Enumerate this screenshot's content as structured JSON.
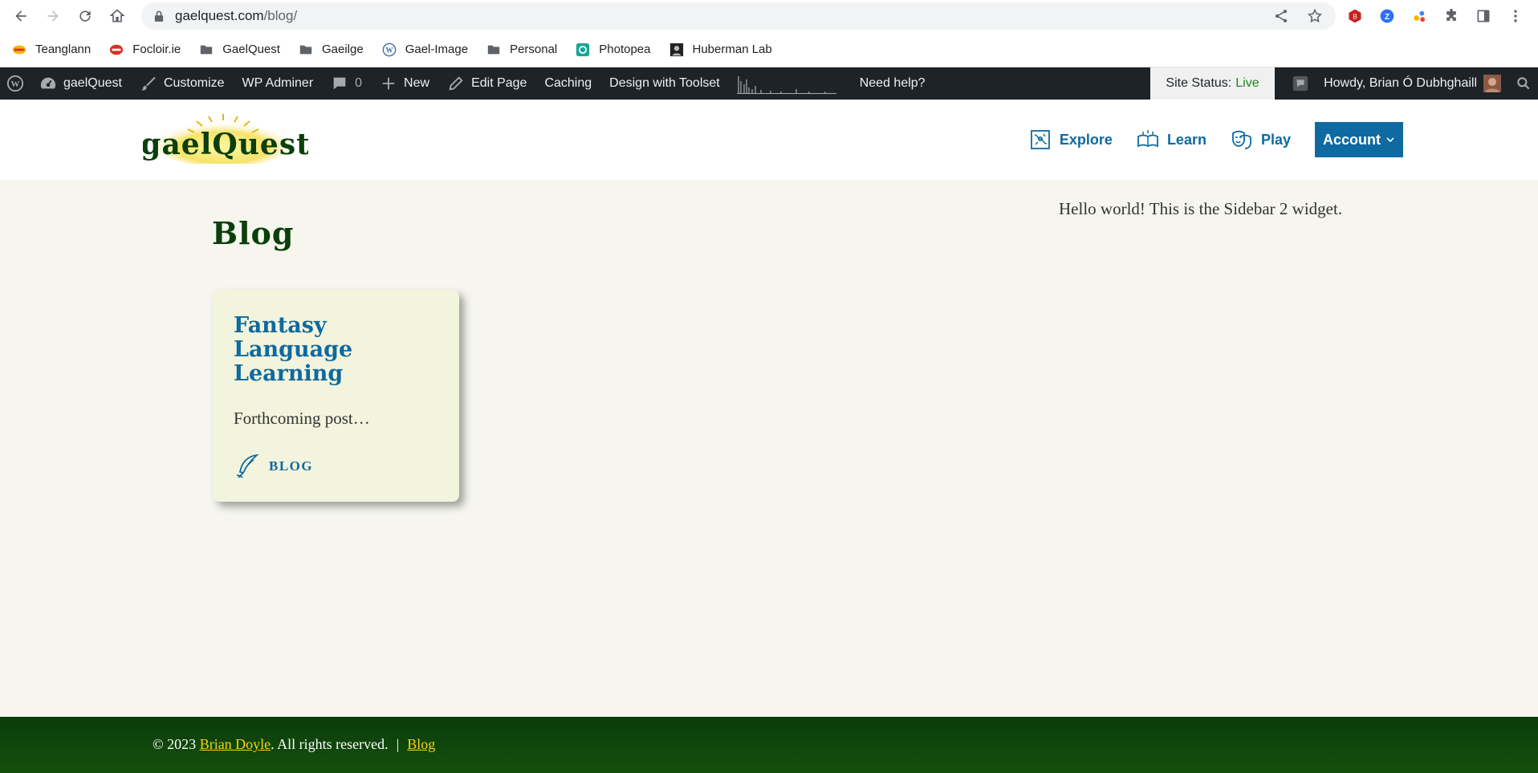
{
  "browser": {
    "url_domain": "gaelquest.com",
    "url_path": "/blog/",
    "bookmarks": [
      {
        "label": "Teanglann",
        "icon": "teanglann-icon"
      },
      {
        "label": "Focloir.ie",
        "icon": "focloir-icon"
      },
      {
        "label": "GaelQuest",
        "icon": "folder-icon"
      },
      {
        "label": "Gaeilge",
        "icon": "folder-icon"
      },
      {
        "label": "Gael-Image",
        "icon": "wordpress-icon"
      },
      {
        "label": "Personal",
        "icon": "folder-icon"
      },
      {
        "label": "Photopea",
        "icon": "photopea-icon"
      },
      {
        "label": "Huberman Lab",
        "icon": "huberman-icon"
      }
    ]
  },
  "adminbar": {
    "site_name": "gaelQuest",
    "customize": "Customize",
    "wp_adminer": "WP Adminer",
    "comments_count": "0",
    "new": "New",
    "edit_page": "Edit Page",
    "caching": "Caching",
    "design": "Design with Toolset",
    "help": "Need help?",
    "site_status_label": "Site Status:",
    "site_status_value": "Live",
    "howdy": "Howdy, Brian Ó Dubhghaill"
  },
  "header": {
    "logo_text": "gaelQuest",
    "nav": {
      "explore": "Explore",
      "learn": "Learn",
      "play": "Play",
      "account": "Account"
    }
  },
  "main": {
    "title": "Blog",
    "post": {
      "title": "Fantasy Language Learning",
      "excerpt": "Forthcoming post…",
      "category": "BLOG"
    },
    "sidebar_text": "Hello world! This is the Sidebar 2 widget."
  },
  "footer": {
    "copyright": "© 2023",
    "author": "Brian Doyle",
    "rights": ". All rights reserved.",
    "separator": "|",
    "blog_link": "Blog"
  },
  "colors": {
    "accent": "#0e6aa0",
    "title_green": "#0b3f0b",
    "footer_link": "#ffd200",
    "live": "#1a8a1a"
  }
}
